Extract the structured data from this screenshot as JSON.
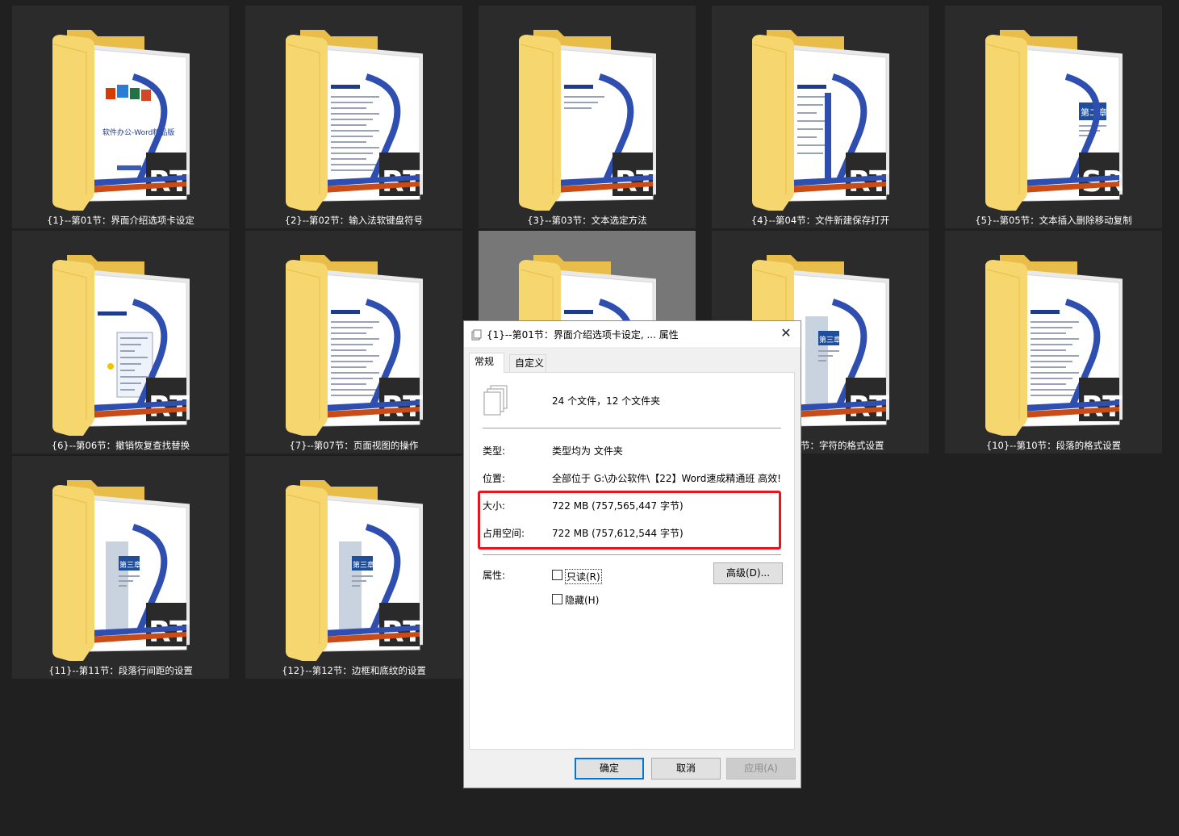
{
  "folders": [
    {
      "caption": "{1}--第01节：界面介绍选项卡设定",
      "thumb_text": "软件办公-Word精品版"
    },
    {
      "caption": "{2}--第02节：输入法软键盘符号"
    },
    {
      "caption": "{3}--第03节：文本选定方法"
    },
    {
      "caption": "{4}--第04节：文件新建保存打开"
    },
    {
      "caption": "{5}--第05节：文本插入删除移动复制",
      "thumb_text": "第二章"
    },
    {
      "caption": "{6}--第06节：撤销恢复查找替换"
    },
    {
      "caption": "{7}--第07节：页面视图的操作"
    },
    {
      "caption": ""
    },
    {
      "caption": "节：字符的格式设置",
      "thumb_text": "第三章"
    },
    {
      "caption": "{10}--第10节：段落的格式设置"
    },
    {
      "caption": "{11}--第11节：段落行间距的设置",
      "thumb_text": "第三章"
    },
    {
      "caption": "{12}--第12节：边框和底纹的设置",
      "thumb_text": "第三章"
    }
  ],
  "srt_label": "SRT",
  "dialog": {
    "title": "{1}--第01节：界面介绍选项卡设定, ... 属性",
    "close_glyph": "✕",
    "tabs": [
      "常规",
      "自定义"
    ],
    "summary": "24 个文件，12 个文件夹",
    "type_label": "类型:",
    "type_value": "类型均为 文件夹",
    "location_label": "位置:",
    "location_value": "全部位于 G:\\办公软件\\【22】Word速成精通班 高效!",
    "size_label": "大小:",
    "size_value": "722 MB (757,565,447 字节)",
    "disk_label": "占用空间:",
    "disk_value": "722 MB (757,612,544 字节)",
    "attr_label": "属性:",
    "readonly_label": "只读(R)",
    "hidden_label": "隐藏(H)",
    "advanced_label": "高级(D)...",
    "ok_label": "确定",
    "cancel_label": "取消",
    "apply_label": "应用(A)"
  },
  "colors": {
    "folder": "#f6d66e",
    "folder_dark": "#e8bd4a",
    "highlight": "#e8161c",
    "accent": "#0078d7"
  }
}
